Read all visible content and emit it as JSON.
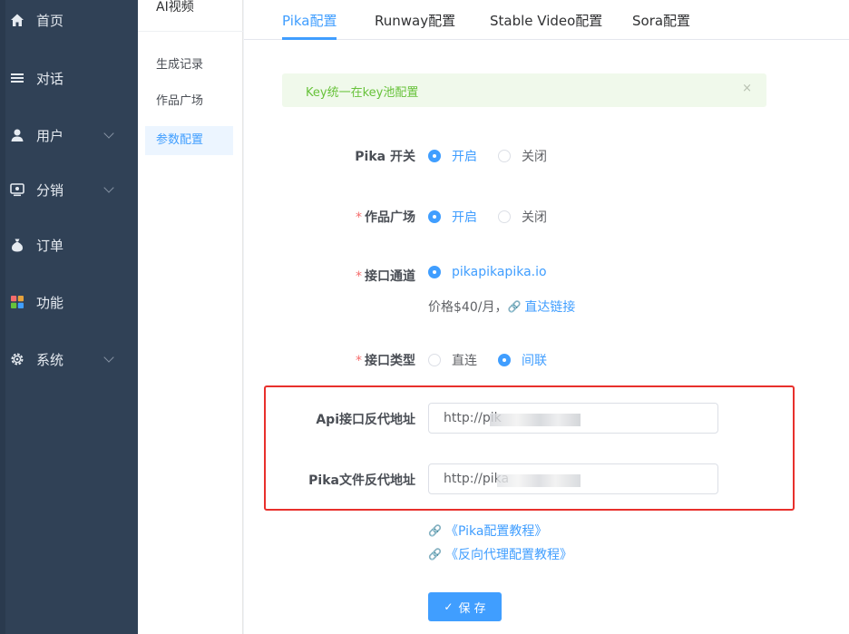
{
  "sidebar": {
    "items": [
      {
        "label": "首页",
        "icon": "home-icon",
        "glyph": "⌂"
      },
      {
        "label": "对话",
        "icon": "menu-icon",
        "glyph": "≡"
      },
      {
        "label": "用户",
        "icon": "user-icon",
        "glyph": "●"
      },
      {
        "label": "分销",
        "icon": "distribution-icon",
        "glyph": "▣"
      },
      {
        "label": "订单",
        "icon": "money-bag-icon",
        "glyph": "♟"
      },
      {
        "label": "功能",
        "icon": "apps-icon",
        "glyph": "▦"
      },
      {
        "label": "系统",
        "icon": "gear-icon",
        "glyph": "⚙"
      }
    ]
  },
  "submenu": {
    "title": "AI视频",
    "items": [
      "生成记录",
      "作品广场",
      "参数配置"
    ]
  },
  "tabs": [
    "Pika配置",
    "Runway配置",
    "Stable Video配置",
    "Sora配置"
  ],
  "alert": {
    "text": "Key统一在key池配置",
    "close": "×"
  },
  "form": {
    "pika_switch": {
      "label": "Pika 开关",
      "on": "开启",
      "off": "关闭"
    },
    "gallery": {
      "label": "作品广场",
      "on": "开启",
      "off": "关闭"
    },
    "channel": {
      "label": "接口通道",
      "option": "pikapikapika.io",
      "price": "价格$40/月，",
      "direct_link": "直达链接"
    },
    "api_type": {
      "label": "接口类型",
      "direct": "直连",
      "indirect": "间联"
    },
    "api_proxy": {
      "label": "Api接口反代地址",
      "value": "http://pik"
    },
    "file_proxy": {
      "label": "Pika文件反代地址",
      "value": "http://pika"
    }
  },
  "docs": [
    "《Pika配置教程》",
    "《反向代理配置教程》"
  ],
  "save_label": "保 存",
  "required_mark": "*",
  "colors": {
    "sidebar": "#304156",
    "primary": "#409eff",
    "success": "#67c23a",
    "danger": "#f56c6c",
    "highlight": "#e8302c"
  }
}
